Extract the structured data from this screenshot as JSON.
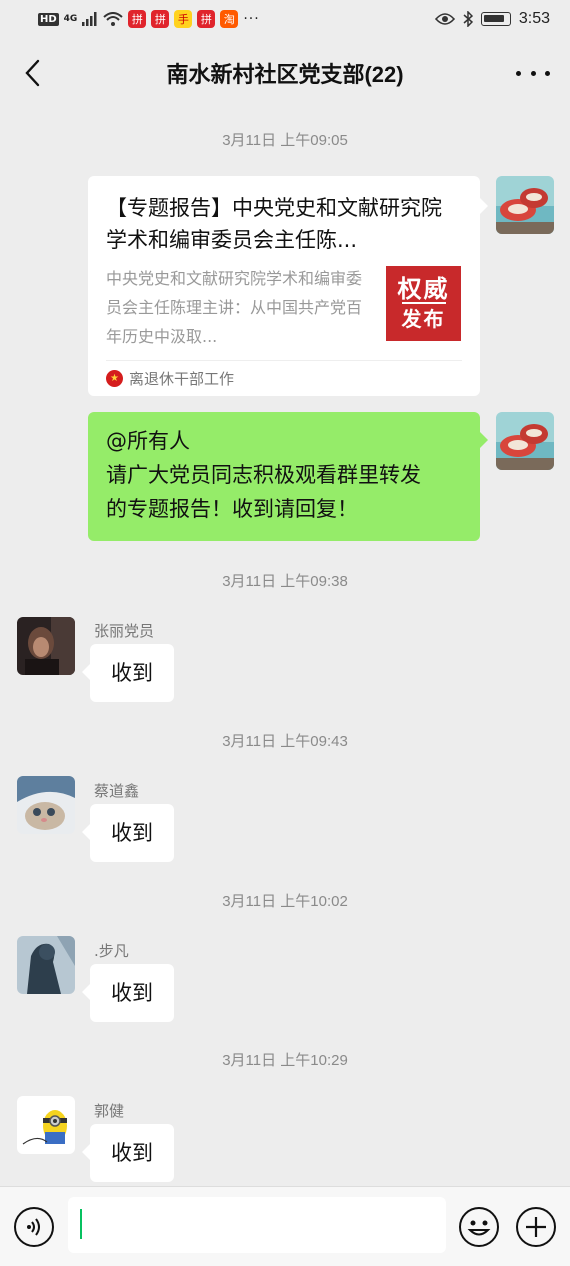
{
  "status_bar": {
    "hd": "HD",
    "network": "4G",
    "apps": [
      "拼",
      "拼",
      "手",
      "拼",
      "淘"
    ],
    "more": "···",
    "time": "3:53"
  },
  "header": {
    "title": "南水新村社区党支部(22)"
  },
  "messages": {
    "ts1": "3月11日 上午09:05",
    "card": {
      "title": "【专题报告】中央党史和文献研究院学术和编审委员会主任陈...",
      "description": "中央党史和文献研究院学术和编审委员会主任陈理主讲：从中国共产党百年历史中汲取...",
      "thumb_line1": "权威",
      "thumb_line2": "发布",
      "source": "离退休干部工作"
    },
    "self_text": {
      "line1": "@所有人",
      "line2": "请广大党员同志积极观看群里转发",
      "line3": "的专题报告！收到请回复！"
    },
    "ts2": "3月11日 上午09:38",
    "m1": {
      "sender": "张丽党员",
      "text": "收到"
    },
    "ts3": "3月11日 上午09:43",
    "m2": {
      "sender": "蔡道鑫",
      "text": "收到"
    },
    "ts4": "3月11日 上午10:02",
    "m3": {
      "sender": ".步凡",
      "text": "收到"
    },
    "ts5": "3月11日 上午10:29",
    "m4": {
      "sender": "郭健",
      "text": "收到"
    }
  },
  "input": {
    "value": ""
  },
  "colors": {
    "background": "#ededed",
    "self_bubble": "#95ec69",
    "other_bubble": "#ffffff",
    "caret": "#07c160"
  }
}
